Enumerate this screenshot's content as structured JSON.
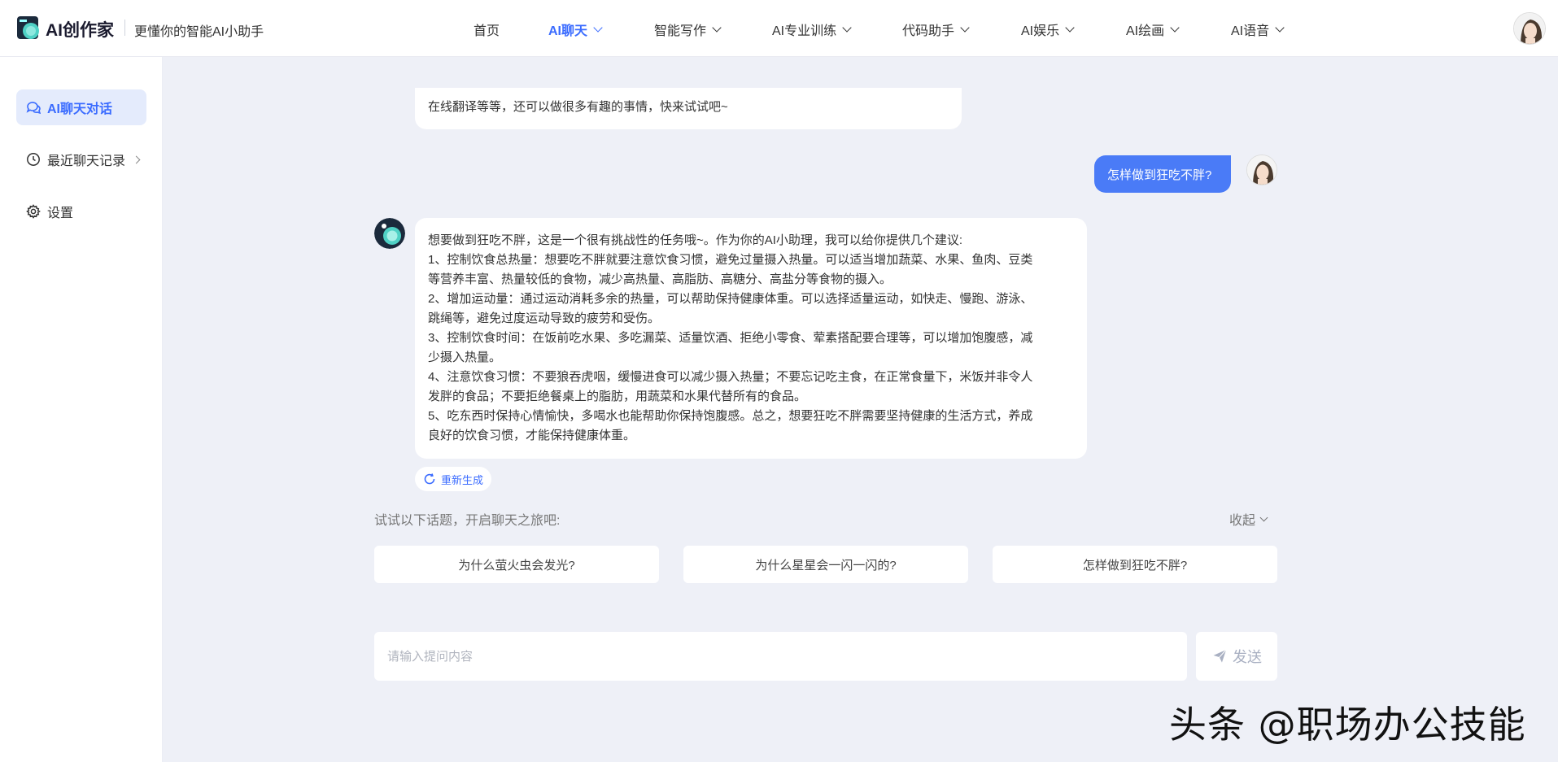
{
  "header": {
    "brand": "AI创作家",
    "tagline": "更懂你的智能AI小助手",
    "nav": [
      {
        "label": "首页",
        "dropdown": false,
        "active": false
      },
      {
        "label": "AI聊天",
        "dropdown": true,
        "active": true
      },
      {
        "label": "智能写作",
        "dropdown": true,
        "active": false
      },
      {
        "label": "AI专业训练",
        "dropdown": true,
        "active": false
      },
      {
        "label": "代码助手",
        "dropdown": true,
        "active": false
      },
      {
        "label": "AI娱乐",
        "dropdown": true,
        "active": false
      },
      {
        "label": "AI绘画",
        "dropdown": true,
        "active": false
      },
      {
        "label": "AI语音",
        "dropdown": true,
        "active": false
      }
    ]
  },
  "sidebar": {
    "items": [
      {
        "label": "AI聊天对话",
        "icon": "chat-bubbles-icon",
        "active": true
      },
      {
        "label": "最近聊天记录",
        "icon": "clock-icon",
        "active": false,
        "has_arrow": true
      },
      {
        "label": "设置",
        "icon": "gear-icon",
        "active": false
      }
    ]
  },
  "chat": {
    "prev_message": "在线翻译等等，还可以做很多有趣的事情，快来试试吧~",
    "user_message": "怎样做到狂吃不胖?",
    "answer_lines": [
      "想要做到狂吃不胖，这是一个很有挑战性的任务哦~。作为你的AI小助理，我可以给你提供几个建议:",
      "1、控制饮食总热量：想要吃不胖就要注意饮食习惯，避免过量摄入热量。可以适当增加蔬菜、水果、鱼肉、豆类",
      "等营养丰富、热量较低的食物，减少高热量、高脂肪、高糖分、高盐分等食物的摄入。",
      "2、增加运动量：通过运动消耗多余的热量，可以帮助保持健康体重。可以选择适量运动，如快走、慢跑、游泳、",
      "跳绳等，避免过度运动导致的疲劳和受伤。",
      "3、控制饮食时间：在饭前吃水果、多吃漏菜、适量饮酒、拒绝小零食、荤素搭配要合理等，可以增加饱腹感，减",
      "少摄入热量。",
      "4、注意饮食习惯：不要狼吞虎咽，缓慢进食可以减少摄入热量；不要忘记吃主食，在正常食量下，米饭并非令人",
      "发胖的食品；不要拒绝餐桌上的脂肪，用蔬菜和水果代替所有的食品。",
      "5、吃东西时保持心情愉快，多喝水也能帮助你保持饱腹感。总之，想要狂吃不胖需要坚持健康的生活方式，养成",
      "良好的饮食习惯，才能保持健康体重。"
    ],
    "regenerate_label": "重新生成"
  },
  "topics": {
    "title": "试试以下话题，开启聊天之旅吧:",
    "collapse_label": "收起",
    "items": [
      "为什么萤火虫会发光?",
      "为什么星星会一闪一闪的?",
      "怎样做到狂吃不胖?"
    ]
  },
  "composer": {
    "placeholder": "请输入提问内容",
    "send_label": "发送"
  },
  "watermark": "头条 @职场办公技能"
}
